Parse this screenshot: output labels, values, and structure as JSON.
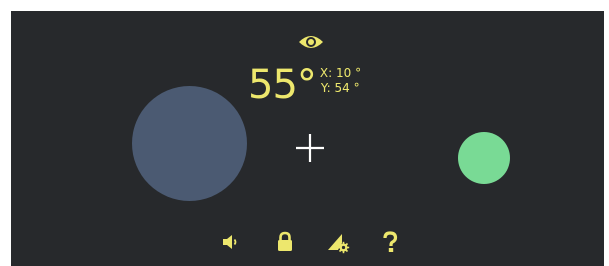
{
  "header": {
    "eye_icon": "eye-icon"
  },
  "orientation": {
    "angle": "55°",
    "x_label": "X: 10 °",
    "y_label": "Y: 54 °"
  },
  "toolbar": {
    "icons": [
      "volume-icon",
      "lock-icon",
      "signal-settings-icon",
      "help-icon"
    ]
  },
  "colors": {
    "background": "#27292c",
    "accent_yellow": "#ede76d",
    "left_circle": "#4b5a72",
    "right_circle": "#79da95",
    "crosshair": "#ffffff"
  }
}
